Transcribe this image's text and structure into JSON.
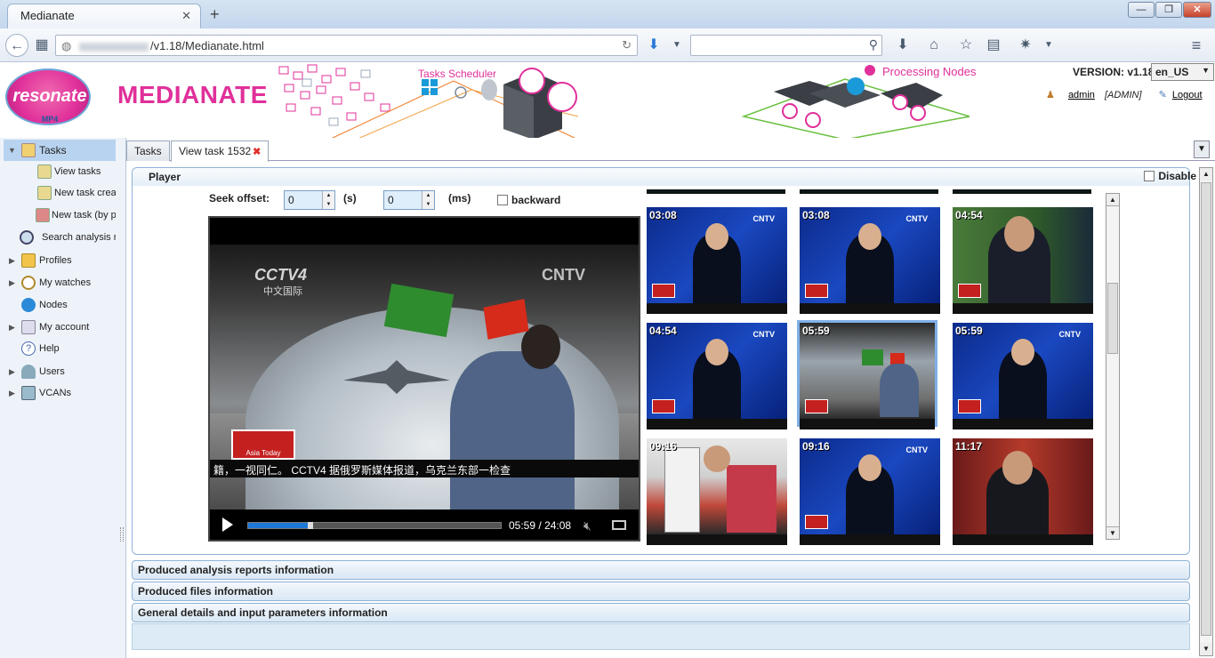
{
  "browser": {
    "tab_title": "Medianate",
    "url": "/v1.18/Medianate.html",
    "new_tab": "+",
    "close": "✕"
  },
  "header": {
    "logo_text": "resonate",
    "logo_sub": "MP4",
    "brand": "MEDIANATE",
    "tasks_scheduler": "Tasks Scheduler",
    "processing_nodes": "Processing Nodes",
    "version": "VERSION: v1.18",
    "language": "en_US",
    "user": "admin",
    "role": "[ADMIN]",
    "logout": "Logout"
  },
  "sidebar": {
    "items": [
      {
        "label": "Tasks"
      },
      {
        "label": "View tasks"
      },
      {
        "label": "New task creation"
      },
      {
        "label": "New task (by profile)"
      },
      {
        "label": "Search analysis reports"
      },
      {
        "label": "Profiles"
      },
      {
        "label": "My watches"
      },
      {
        "label": "Nodes"
      },
      {
        "label": "My account"
      },
      {
        "label": "Help"
      },
      {
        "label": "Users"
      },
      {
        "label": "VCANs"
      }
    ]
  },
  "main": {
    "tabs": [
      {
        "label": "Tasks"
      },
      {
        "label": "View task 1532"
      }
    ],
    "player": {
      "title": "Player",
      "disable_label": "Disable",
      "seek_offset_label": "Seek offset:",
      "seek_s_value": "0",
      "seek_s_unit": "(s)",
      "seek_ms_value": "0",
      "seek_ms_unit": "(ms)",
      "backward_label": "backward",
      "current_time": "05:59",
      "separator": "/",
      "duration": "24:08",
      "progress": 0.248,
      "video": {
        "channel": "CCTV4",
        "channel_sub": "中文国际",
        "watermark": "CNTV",
        "program": "Asia Today",
        "ticker": "籍，一视同仁。 CCTV4 据俄罗斯媒体报道，乌克兰东部一检查"
      },
      "thumbnails": [
        {
          "time": "03:08",
          "scene": "studio"
        },
        {
          "time": "03:08",
          "scene": "studio"
        },
        {
          "time": "04:54",
          "scene": "interview"
        },
        {
          "time": "04:54",
          "scene": "studio"
        },
        {
          "time": "05:59",
          "scene": "hangar",
          "selected": true
        },
        {
          "time": "05:59",
          "scene": "studio"
        },
        {
          "time": "09:16",
          "scene": "crowd"
        },
        {
          "time": "09:16",
          "scene": "studio"
        },
        {
          "time": "11:17",
          "scene": "press"
        }
      ]
    },
    "sections": [
      {
        "label": "Produced analysis reports information"
      },
      {
        "label": "Produced files information"
      },
      {
        "label": "General details and input parameters information"
      }
    ]
  }
}
